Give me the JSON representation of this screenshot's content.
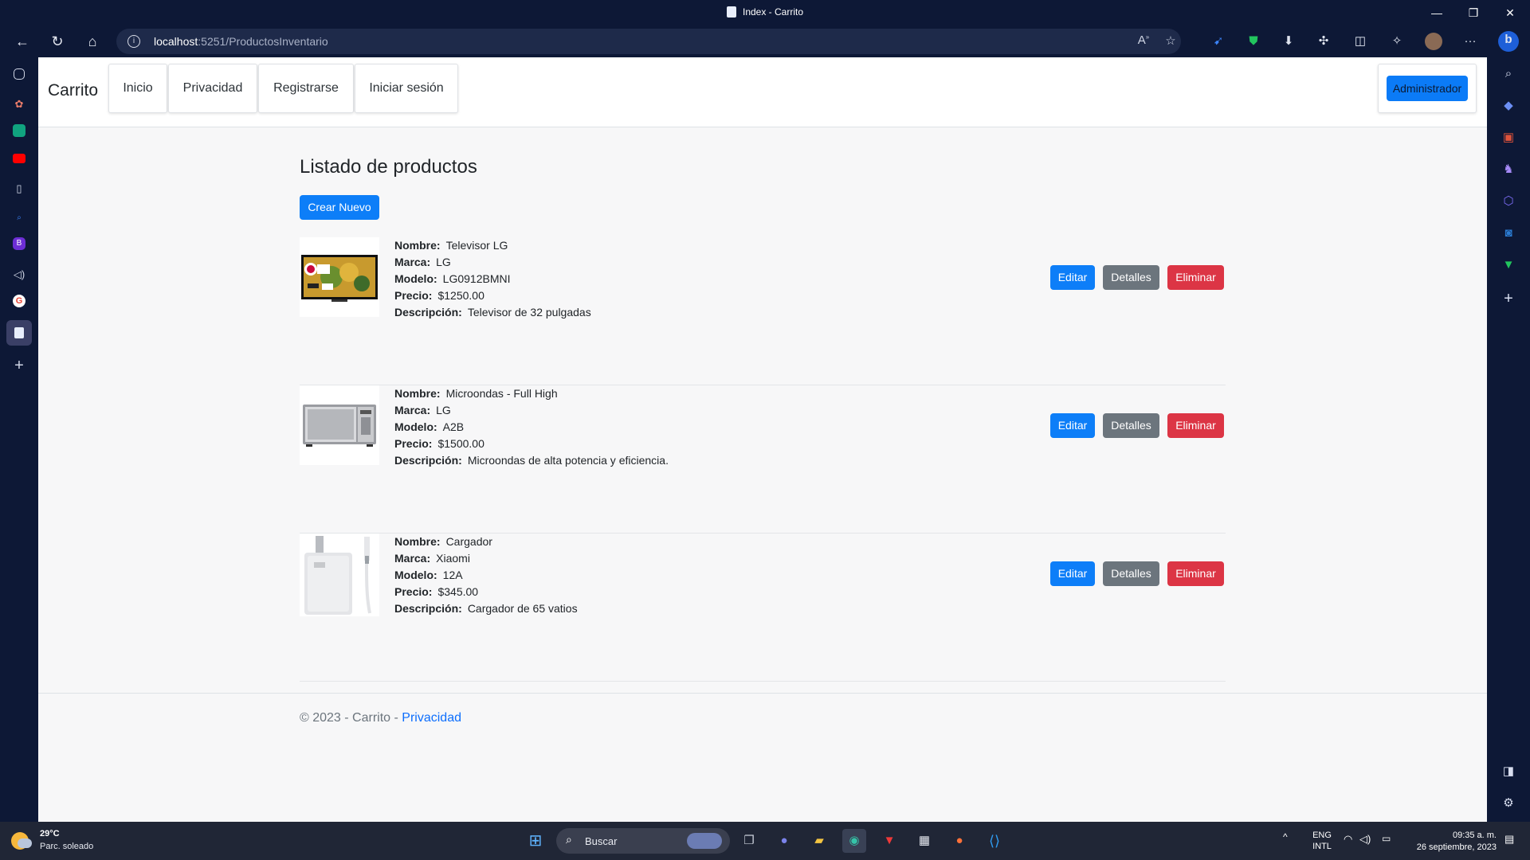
{
  "window": {
    "title": "Index - Carrito",
    "controls": {
      "minimize": "—",
      "restore": "❐",
      "close": "✕"
    }
  },
  "browser": {
    "url_host": "localhost",
    "url_rest": ":5251/ProductosInventario",
    "info_glyph": "i",
    "back_glyph": "←",
    "refresh_glyph": "↻",
    "home_glyph": "⌂",
    "more_glyph": "···"
  },
  "site": {
    "brand": "Carrito",
    "nav": [
      {
        "label": "Inicio"
      },
      {
        "label": "Privacidad"
      },
      {
        "label": "Registrarse"
      },
      {
        "label": "Iniciar sesión"
      }
    ],
    "admin_label": "Administrador"
  },
  "main": {
    "title": "Listado de productos",
    "create_label": "Crear Nuevo",
    "field_labels": {
      "name": "Nombre:",
      "brand": "Marca:",
      "model": "Modelo:",
      "price": "Precio:",
      "description": "Descripción:"
    },
    "actions": {
      "edit": "Editar",
      "details": "Detalles",
      "delete": "Eliminar"
    },
    "products": [
      {
        "name": "Televisor LG",
        "brand": "LG",
        "model": "LG0912BMNI",
        "price": "$1250.00",
        "description": "Televisor de 32 pulgadas",
        "image": "tv"
      },
      {
        "name": "Microondas - Full High",
        "brand": "LG",
        "model": "A2B",
        "price": "$1500.00",
        "description": "Microondas de alta potencia y eficiencia.",
        "image": "microwave"
      },
      {
        "name": "Cargador",
        "brand": "Xiaomi",
        "model": "12A",
        "price": "$345.00",
        "description": "Cargador de 65 vatios",
        "image": "charger"
      }
    ]
  },
  "footer": {
    "text": "© 2023 - Carrito - ",
    "link": "Privacidad"
  },
  "taskbar": {
    "weather_temp": "29°C",
    "weather_desc": "Parc. soleado",
    "search_placeholder": "Buscar",
    "lang_top": "ENG",
    "lang_bottom": "INTL",
    "time": "09:35 a. m.",
    "date": "26 septiembre, 2023"
  },
  "colors": {
    "primary": "#0d7ef8",
    "secondary": "#6c757d",
    "danger": "#dc3545",
    "browser_chrome": "#0d1836",
    "taskbar": "#202636"
  }
}
